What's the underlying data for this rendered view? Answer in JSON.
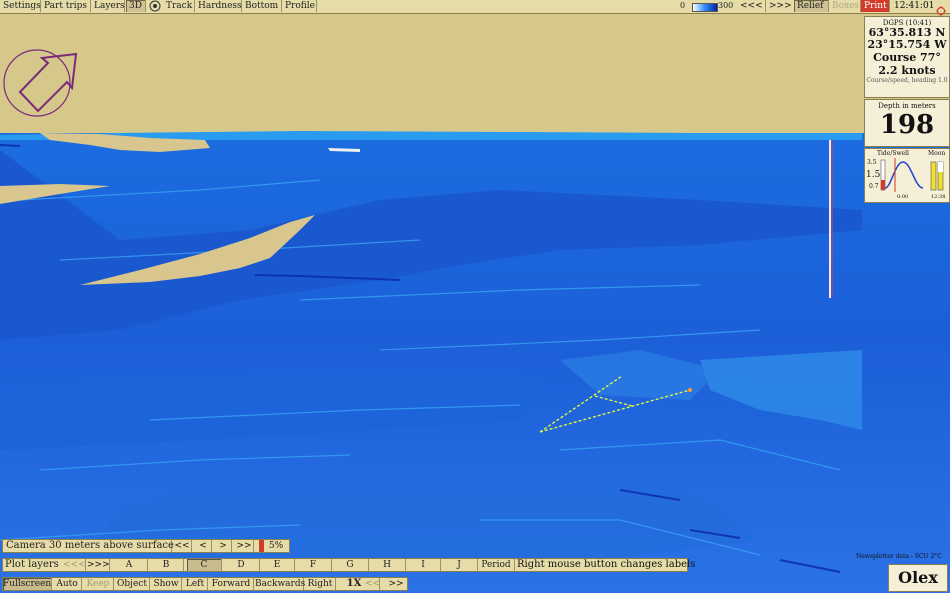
{
  "toolbar": {
    "items": [
      "Settings",
      "Part trips",
      "Layers",
      "3D",
      "Track",
      "Hardness",
      "Bottom",
      "Profile"
    ],
    "depth_scale_min": "0",
    "depth_scale_max": "300",
    "nav_prev": "<<<",
    "nav_next": ">>>",
    "relief": "Relief",
    "boxes": "Boxes",
    "print": "Print",
    "clock": "12:41:01"
  },
  "position_panel": {
    "header": "DGPS (10:41)",
    "lat": "63°35.813 N",
    "lon": "23°15.754 W",
    "course": "Course 77°",
    "speed": "2.2 knots",
    "sub": "Course/speed, heading 1.0"
  },
  "depth_panel": {
    "label": "Depth in meters",
    "value": "198"
  },
  "tide_panel": {
    "label_left": "Tide/Swell",
    "label_right": "Moon",
    "tick_top": "3.5",
    "tick_mid": "1.5",
    "tick_bottom": "0.7",
    "time_left": "0:00",
    "time_right": "12:38"
  },
  "camera_bar": {
    "text": "Camera 30 meters above surface",
    "buttons": [
      "<<",
      "<",
      ">",
      ">>"
    ],
    "percent": "5%"
  },
  "plot_layers": {
    "label": "Plot layers",
    "prev": "<<<",
    "next": ">>>",
    "layers": [
      "A",
      "B",
      "C",
      "D",
      "E",
      "F",
      "G",
      "H",
      "I",
      "J"
    ],
    "selected": "C",
    "period": "Period",
    "note": "Right mouse button changes labels"
  },
  "bottom_bar": {
    "items": [
      "Fullscreen",
      "Auto",
      "Keep",
      "Object",
      "Show",
      "Left",
      "Forward",
      "Backwards",
      "Right"
    ],
    "multiplier": "1X",
    "prev": "<<",
    "next": ">>"
  },
  "data_source": "Newsplotter data - SCU 2°C",
  "brand": "Olex",
  "colors": {
    "sea": "#1d5fd6",
    "sea_light": "#2f8bef",
    "sky": "#d6c88a",
    "land": "#d8c68e",
    "track": "#e6ff38"
  }
}
